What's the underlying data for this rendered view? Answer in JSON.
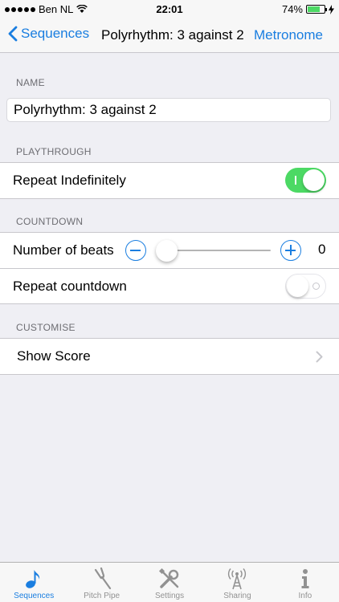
{
  "status": {
    "carrier": "Ben NL",
    "time": "22:01",
    "battery": "74%",
    "battery_level": 0.74
  },
  "nav": {
    "back_label": "Sequences",
    "title": "Polyrhythm: 3 against 2",
    "right_label": "Metronome"
  },
  "sections": {
    "name": "NAME",
    "playthrough": "PLAYTHROUGH",
    "countdown": "COUNTDOWN",
    "customise": "CUSTOMISE"
  },
  "name_field": {
    "value": "Polyrhythm: 3 against 2"
  },
  "playthrough": {
    "repeat_label": "Repeat Indefinitely",
    "repeat_on": true
  },
  "countdown": {
    "beats_label": "Number of beats",
    "beats_value": "0",
    "repeat_label": "Repeat countdown",
    "repeat_on": false
  },
  "customise": {
    "show_score_label": "Show Score"
  },
  "tabs": [
    {
      "label": "Sequences",
      "icon": "music-note-icon",
      "active": true
    },
    {
      "label": "Pitch Pipe",
      "icon": "tuning-fork-icon",
      "active": false
    },
    {
      "label": "Settings",
      "icon": "tools-icon",
      "active": false
    },
    {
      "label": "Sharing",
      "icon": "antenna-icon",
      "active": false
    },
    {
      "label": "Info",
      "icon": "info-icon",
      "active": false
    }
  ],
  "colors": {
    "accent": "#1a7ee0",
    "toggle_on": "#4cd964",
    "background": "#efeff4"
  }
}
